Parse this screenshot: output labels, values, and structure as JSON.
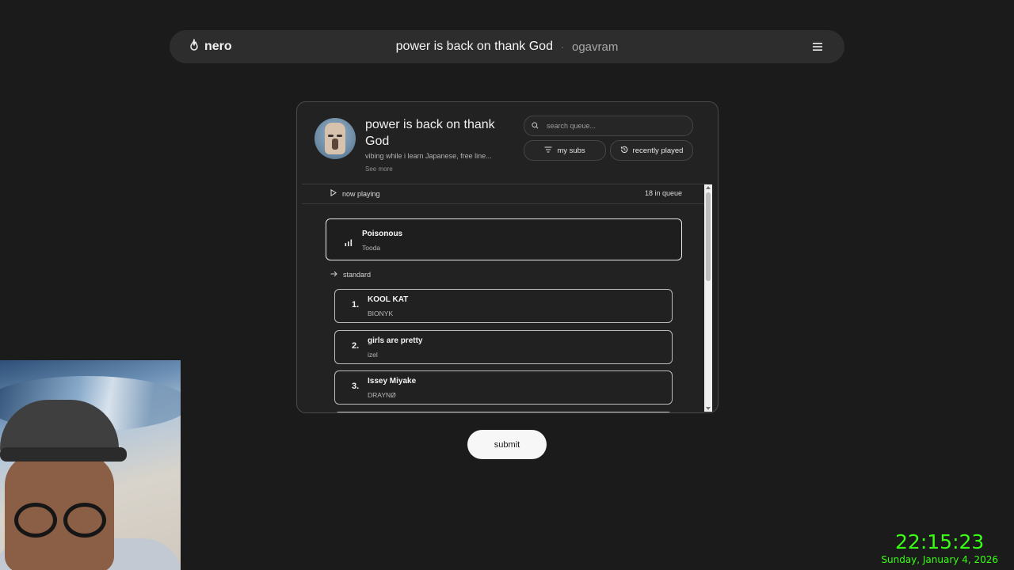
{
  "app": {
    "name": "nero",
    "logo_icon": "flame-icon",
    "menu_icon": "hamburger-menu-icon"
  },
  "header": {
    "title": "power is back on thank God",
    "separator": "·",
    "username": "ogavram"
  },
  "playlist": {
    "title": "power is back on thank God",
    "description": "vibing while i learn Japanese, free line...",
    "see_more": "See more",
    "search_placeholder": "search queue...",
    "buttons": {
      "my_subs": "my subs",
      "recently_played": "recently played"
    }
  },
  "queue": {
    "now_playing_label": "now playing",
    "count_label": "18 in queue",
    "current": {
      "title": "Poisonous",
      "artist": "Tooda"
    },
    "section_label": "standard",
    "items": [
      {
        "num": "1.",
        "title": "KOOL KAT",
        "artist": "BIONYK"
      },
      {
        "num": "2.",
        "title": "girls are pretty",
        "artist": "izel"
      },
      {
        "num": "3.",
        "title": "Issey Miyake",
        "artist": "DRAYNØ"
      }
    ]
  },
  "submit_label": "submit",
  "overlay": {
    "time": "22:15:23",
    "date": "Sunday, January 4, 2026",
    "color": "#39ff14"
  },
  "colors": {
    "background": "#1b1b1b",
    "card": "#222222",
    "topbar": "#2d2d2d"
  }
}
